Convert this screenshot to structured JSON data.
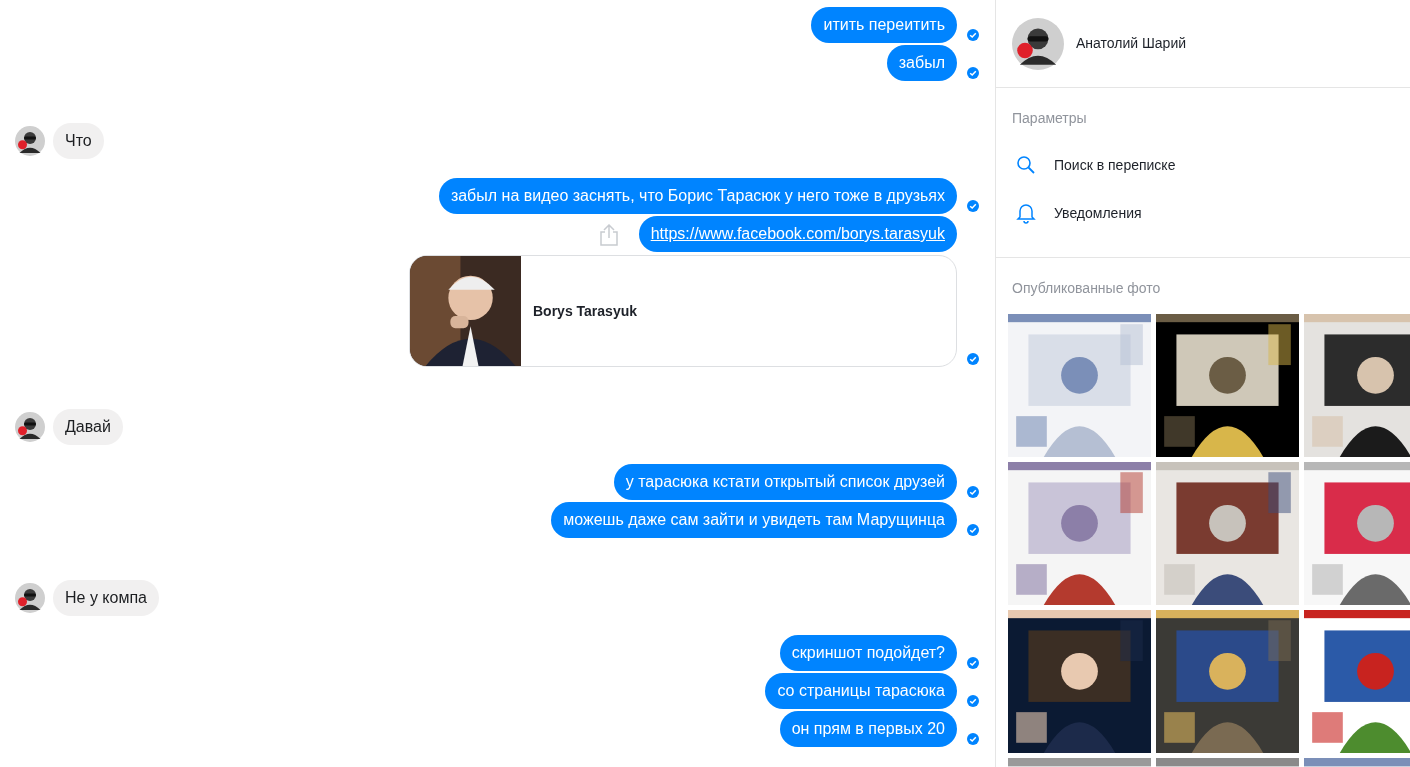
{
  "chat": {
    "groups": [
      {
        "kind": "outgoing",
        "messages": [
          {
            "kind": "text",
            "text": "итить переитить"
          },
          {
            "kind": "text",
            "text": "забыл"
          }
        ]
      },
      {
        "kind": "incoming",
        "messages": [
          {
            "kind": "text",
            "text": "Что"
          }
        ]
      },
      {
        "kind": "outgoing",
        "messages": [
          {
            "kind": "text",
            "text": "забыл на видео заснять, что Борис Тарасюк у него тоже в друзьях"
          },
          {
            "kind": "link",
            "text": "https://www.facebook.com/borys.tarasyuk"
          },
          {
            "kind": "preview",
            "title": "Borys Tarasyuk"
          }
        ]
      },
      {
        "kind": "incoming",
        "messages": [
          {
            "kind": "text",
            "text": "Давай"
          }
        ]
      },
      {
        "kind": "outgoing",
        "messages": [
          {
            "kind": "text",
            "text": "у тарасюка кстати открытый список друзей"
          },
          {
            "kind": "text",
            "text": "можешь даже сам зайти и увидеть там Марущинца"
          }
        ]
      },
      {
        "kind": "incoming",
        "messages": [
          {
            "kind": "text",
            "text": "Не у компа"
          }
        ]
      },
      {
        "kind": "outgoing",
        "messages": [
          {
            "kind": "text",
            "text": "скриншот подойдет?"
          },
          {
            "kind": "text",
            "text": "со страницы тарасюка"
          },
          {
            "kind": "text",
            "text": "он прям в первых 20"
          }
        ]
      }
    ]
  },
  "sidebar": {
    "contact_name": "Анатолий Шарий",
    "options_title": "Параметры",
    "options": [
      {
        "kind": "search",
        "label": "Поиск в переписке"
      },
      {
        "kind": "bell",
        "label": "Уведомления"
      }
    ],
    "photos_title": "Опубликованные фото"
  }
}
